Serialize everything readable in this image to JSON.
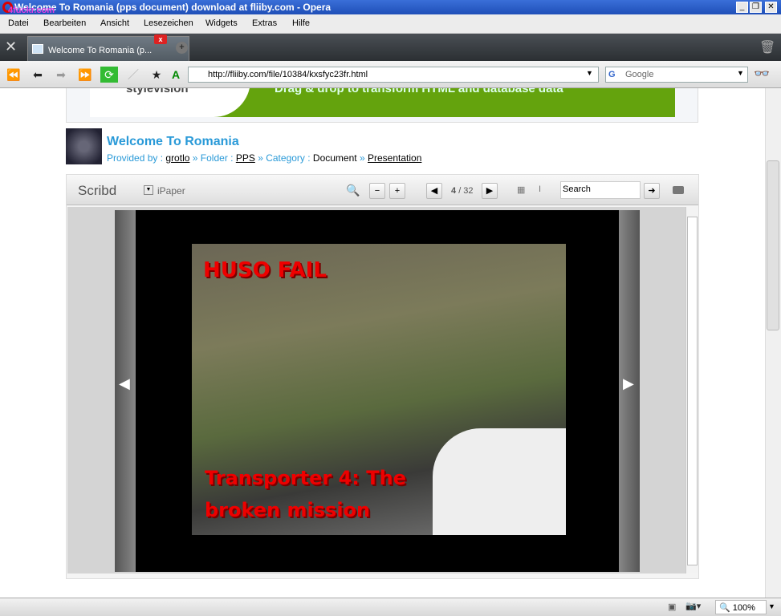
{
  "window": {
    "title": "Welcome To Romania (pps document) download at fliiby.com - Opera",
    "watermark": "4fuckr.com"
  },
  "menu": [
    "Datei",
    "Bearbeiten",
    "Ansicht",
    "Lesezeichen",
    "Widgets",
    "Extras",
    "Hilfe"
  ],
  "tab": {
    "label": "Welcome To Romania (p...",
    "close": "x"
  },
  "address": {
    "url": "http://fliiby.com/file/10384/kxsfyc23fr.html",
    "search_placeholder": "Google"
  },
  "banner": {
    "brand": "stylevision",
    "tagline": "Drag & drop to transform HTML and database data"
  },
  "doc": {
    "title": "Welcome To Romania",
    "provided_label": "Provided by :",
    "user": "grotlo",
    "sep1": "»",
    "folder_label": "Folder :",
    "folder": "PPS",
    "sep2": "»",
    "category_label": "Category :",
    "category": "Document",
    "sep3": "»",
    "subcategory": "Presentation"
  },
  "viewer": {
    "brand": "Scribd",
    "mode": "iPaper",
    "page": "4",
    "total": "/ 32",
    "search_placeholder": "Search"
  },
  "slide": {
    "caption_top": "HUSO FAIL",
    "caption_bottom_1": "Transporter 4: The",
    "caption_bottom_2": "broken mission"
  },
  "status": {
    "zoom": "100%"
  }
}
